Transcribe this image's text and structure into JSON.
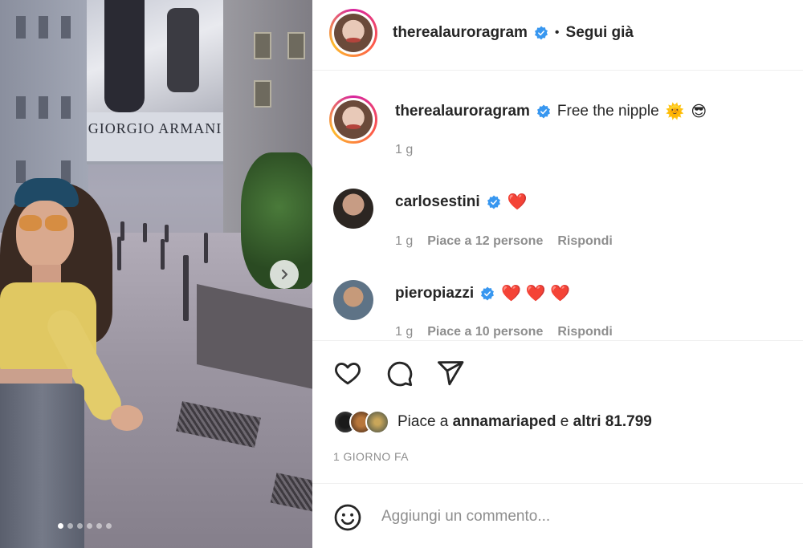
{
  "photo": {
    "billboard_text": "GIORGIO ARMANI",
    "carousel_dots": 6,
    "active_dot": 0,
    "next_icon": "chevron-right-icon"
  },
  "header": {
    "username": "therealauroragram",
    "separator": "•",
    "follow_status": "Segui già",
    "verified_icon": "verified-badge-icon"
  },
  "caption": {
    "username": "therealauroragram",
    "text": "Free the nipple",
    "emojis": [
      "🌞",
      "😎"
    ],
    "time": "1 g"
  },
  "comments": [
    {
      "username": "carlosestini",
      "text": "❤️",
      "time": "1 g",
      "likes": "Piace a 12 persone",
      "reply": "Rispondi"
    },
    {
      "username": "pieropiazzi",
      "text": "❤️ ❤️ ❤️",
      "time": "1 g",
      "likes": "Piace a 10 persone",
      "reply": "Rispondi"
    }
  ],
  "actions": {
    "like_icon": "heart-icon",
    "comment_icon": "comment-bubble-icon",
    "share_icon": "paper-plane-icon"
  },
  "likes": {
    "prefix": "Piace a",
    "user": "annamariaped",
    "conj": "e",
    "others": "altri 81.799"
  },
  "time_ago": "1 GIORNO FA",
  "add_comment": {
    "placeholder": "Aggiungi un commento...",
    "emoji_icon": "smiley-icon"
  },
  "colors": {
    "verified": "#3897f0",
    "heart": "#ed1c24",
    "muted": "#8e8e8e",
    "text": "#262626"
  }
}
